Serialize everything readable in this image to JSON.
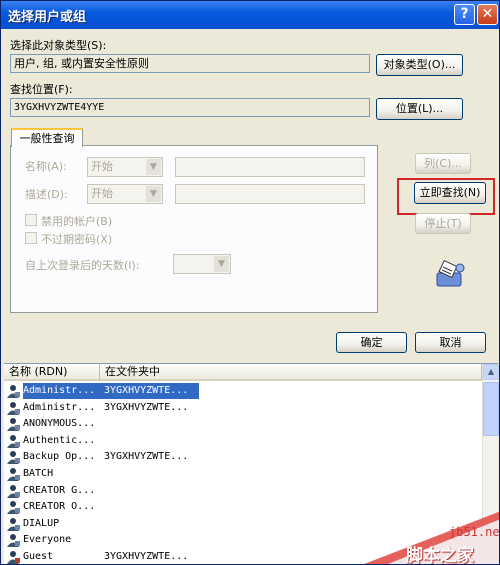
{
  "window": {
    "title": "选择用户或组",
    "help_glyph": "?",
    "close_glyph": "✕"
  },
  "object_type": {
    "label": "选择此对象类型(S):",
    "value": "用户, 组, 或内置安全性原则",
    "button": "对象类型(O)..."
  },
  "location": {
    "label": "查找位置(F):",
    "value": "3YGXHVYZWTE4YYE",
    "button": "位置(L)..."
  },
  "query_tab": {
    "label": "一般性查询",
    "name_label": "名称(A):",
    "name_mode": "开始",
    "desc_label": "描述(D):",
    "desc_mode": "开始",
    "disabled_accounts": "禁用的帐户(B)",
    "non_expiring_pw": "不过期密码(X)",
    "days_since_logon": "自上次登录后的天数(I):"
  },
  "side_buttons": {
    "columns": "列(C)...",
    "find_now": "立即查找(N)",
    "stop": "停止(T)"
  },
  "dialog_buttons": {
    "ok": "确定",
    "cancel": "取消"
  },
  "results": {
    "columns": [
      "名称 (RDN)",
      "在文件夹中"
    ],
    "rows": [
      {
        "name": "Administr...",
        "folder": "3YGXHVYZWTE...",
        "selected": true
      },
      {
        "name": "Administr...",
        "folder": "3YGXHVYZWTE...",
        "selected": false
      },
      {
        "name": "ANONYMOUS...",
        "folder": "",
        "selected": false
      },
      {
        "name": "Authentic...",
        "folder": "",
        "selected": false
      },
      {
        "name": "Backup Op...",
        "folder": "3YGXHVYZWTE...",
        "selected": false
      },
      {
        "name": "BATCH",
        "folder": "",
        "selected": false
      },
      {
        "name": "CREATOR G...",
        "folder": "",
        "selected": false
      },
      {
        "name": "CREATOR O...",
        "folder": "",
        "selected": false
      },
      {
        "name": "DIALUP",
        "folder": "",
        "selected": false
      },
      {
        "name": "Everyone",
        "folder": "",
        "selected": false
      },
      {
        "name": "Guest",
        "folder": "3YGXHVYZWTE...",
        "selected": false
      }
    ]
  },
  "watermark": {
    "site": "jb51.net",
    "brand": "脚本之家"
  },
  "colors": {
    "titlebar": "#0454D8",
    "selection": "#316AC5",
    "highlight_box": "#D0282A",
    "dialog_bg": "#ECE9D8"
  }
}
